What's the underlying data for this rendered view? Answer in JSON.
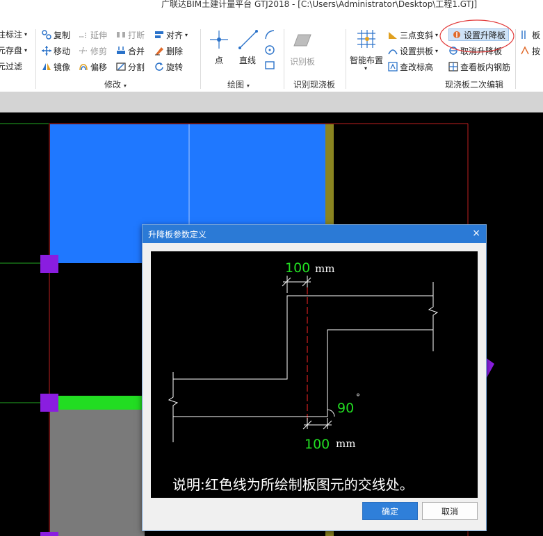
{
  "title": "广联达BIM土建计量平台 GTJ2018 - [C:\\Users\\Administrator\\Desktop\\工程1.GTJ]",
  "ribbon": {
    "left_cut": [
      "注标注",
      "元存盘",
      "元过滤"
    ],
    "modify": {
      "items": [
        "复制",
        "延伸",
        "打断",
        "对齐",
        "移动",
        "修剪",
        "合并",
        "删除",
        "镜像",
        "偏移",
        "分割",
        "旋转"
      ],
      "group_label": "修改"
    },
    "draw": {
      "point": "点",
      "line": "直线",
      "group_label": "绘图"
    },
    "identify": {
      "btn": "识别板",
      "group_label": "识别现浇板"
    },
    "slab_edit": {
      "smart_layout": "智能布置",
      "three_point_slope": "三点变斜",
      "set_arch": "设置拱板",
      "check_elevation": "查改标高",
      "set_raise_lower": "设置升降板",
      "cancel_raise_lower": "取消升降板",
      "view_rebar": "查看板内钢筋",
      "group_label": "现浇板二次编辑"
    },
    "right_cut": [
      "板",
      "按"
    ]
  },
  "dialog": {
    "title": "升降板参数定义",
    "close_glyph": "×",
    "diagram": {
      "top_dim_value": "100",
      "top_dim_unit": "mm",
      "angle_value": "90",
      "angle_unit": "°",
      "bottom_dim_value": "100",
      "bottom_dim_unit": "mm",
      "note": "说明:红色线为所绘制板图元的交线处。"
    },
    "ok_label": "确定",
    "cancel_label": "取消"
  },
  "colors": {
    "dialog_title": "#2b7ad6",
    "ok_button": "#2f7fd9",
    "slab_blue": "#1f78ff",
    "slab_grey": "#7a7a7a",
    "green_value": "#22dd22",
    "red_centerline": "#d42020",
    "magenta_node": "#8a1de0",
    "highlight_circle": "#e23b3b"
  }
}
